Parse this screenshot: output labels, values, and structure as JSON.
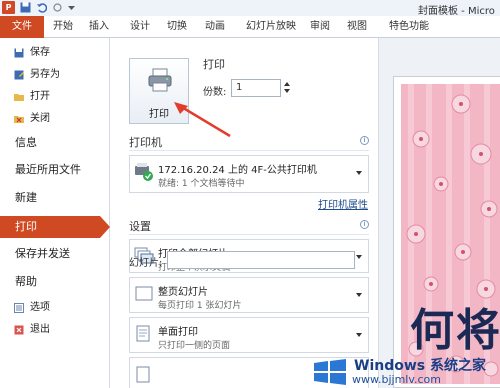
{
  "window": {
    "title": "封面模板 - Micro"
  },
  "ribbon": {
    "tabs": [
      {
        "label": "文件"
      },
      {
        "label": "开始"
      },
      {
        "label": "插入"
      },
      {
        "label": "设计"
      },
      {
        "label": "切换"
      },
      {
        "label": "动画"
      },
      {
        "label": "幻灯片放映"
      },
      {
        "label": "审阅"
      },
      {
        "label": "视图"
      },
      {
        "label": "特色功能"
      }
    ]
  },
  "nav": {
    "items": [
      {
        "label": "保存",
        "icon": "save-icon"
      },
      {
        "label": "另存为",
        "icon": "save-as-icon"
      },
      {
        "label": "打开",
        "icon": "open-folder-icon"
      },
      {
        "label": "关闭",
        "icon": "close-doc-icon"
      },
      {
        "label": "信息"
      },
      {
        "label": "最近所用文件"
      },
      {
        "label": "新建"
      },
      {
        "label": "打印"
      },
      {
        "label": "保存并发送"
      },
      {
        "label": "帮助"
      },
      {
        "label": "选项",
        "icon": "options-icon"
      },
      {
        "label": "退出",
        "icon": "exit-icon"
      }
    ]
  },
  "print": {
    "heading": "打印",
    "button_label": "打印",
    "copies_label": "份数:",
    "copies_value": "1"
  },
  "printer": {
    "heading": "打印机",
    "name": "172.16.20.24 上的 4F-公共打印机",
    "status": "就绪: 1 个文档等待中",
    "properties_link": "打印机属性"
  },
  "settings": {
    "heading": "设置",
    "range_title": "打印全部幻灯片",
    "range_desc": "打印整个演示文稿",
    "slides_label": "幻灯片:",
    "slides_value": "",
    "layout_title": "整页幻灯片",
    "layout_desc": "每页打印 1 张幻灯片",
    "sides_title": "单面打印",
    "sides_desc": "只打印一侧的页面"
  },
  "preview": {
    "slide_title": "何将"
  },
  "watermark": {
    "brand": "Windows 系统之家",
    "url": "www.bjjmlv.com"
  },
  "colors": {
    "accent": "#cf4a23",
    "slide_bg": "#f3b6c4",
    "title_text": "#1b2a55"
  }
}
